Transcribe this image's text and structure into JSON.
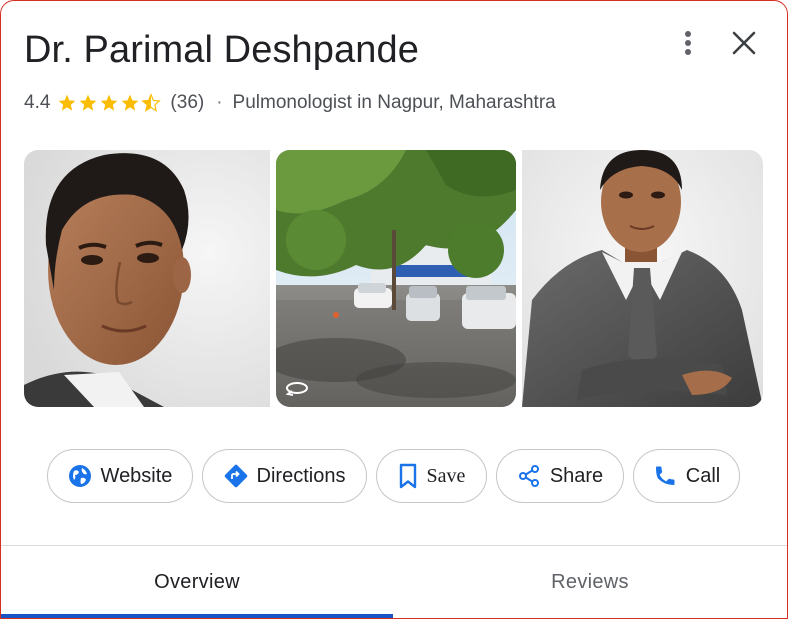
{
  "place": {
    "name": "Dr. Parimal Deshpande",
    "rating": "4.4",
    "stars_filled": 4.5,
    "stars_total": 5,
    "review_count": "(36)",
    "separator": "·",
    "category": "Pulmonologist in Nagpur, Maharashtra"
  },
  "photos": [
    {
      "subject": "doctor-portrait-closeup"
    },
    {
      "subject": "street-view-building",
      "icon": "street-view-360-icon"
    },
    {
      "subject": "doctor-portrait-suit"
    }
  ],
  "actions": {
    "website": "Website",
    "directions": "Directions",
    "save": "Save",
    "share": "Share",
    "call": "Call"
  },
  "tabs": {
    "overview": "Overview",
    "reviews": "Reviews",
    "selected": "Overview"
  },
  "colors": {
    "star": "#fbbc04",
    "action_blue": "#1a73e8",
    "tab_indicator": "#1a53c4",
    "frame_border": "#d93025"
  }
}
